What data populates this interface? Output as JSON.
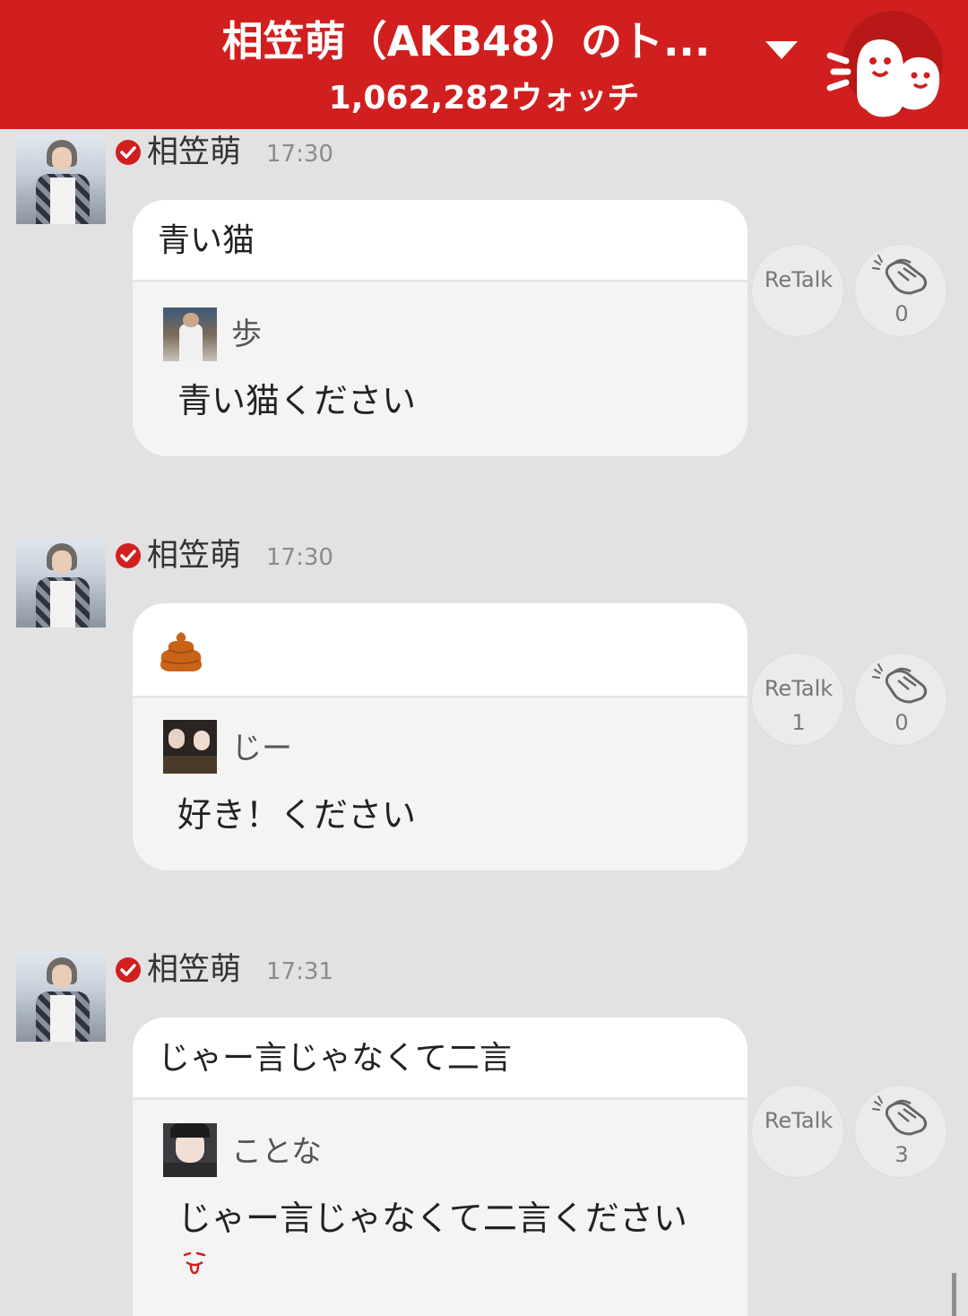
{
  "colors": {
    "brand_red": "#d11f1f",
    "background": "#e2e2e2"
  },
  "header": {
    "title": "相笠萌（AKB48）のト...",
    "watch_count": "1,062,282ウォッチ",
    "dropdown_icon": "triangle-down-icon",
    "mascot_icon": "ghost-mascot-icon"
  },
  "messages": [
    {
      "author": "相笠萌",
      "time": "17:30",
      "body": "青い猫",
      "quote": {
        "name": "歩",
        "text": "青い猫ください"
      },
      "retalk_label": "ReTalk",
      "retalk_count": "",
      "clap_count": "0"
    },
    {
      "author": "相笠萌",
      "time": "17:30",
      "body": "",
      "body_icon": "poop-emoji-icon",
      "quote": {
        "name": "じー",
        "text": "好き！ください"
      },
      "retalk_label": "ReTalk",
      "retalk_count": "1",
      "clap_count": "0"
    },
    {
      "author": "相笠萌",
      "time": "17:31",
      "body": "じゃー言じゃなくて二言",
      "quote": {
        "name": "ことな",
        "text": "じゃー言じゃなくて二言ください",
        "emoji_icon": "tongue-out-emoji-icon"
      },
      "retalk_label": "ReTalk",
      "retalk_count": "",
      "clap_count": "3"
    }
  ]
}
